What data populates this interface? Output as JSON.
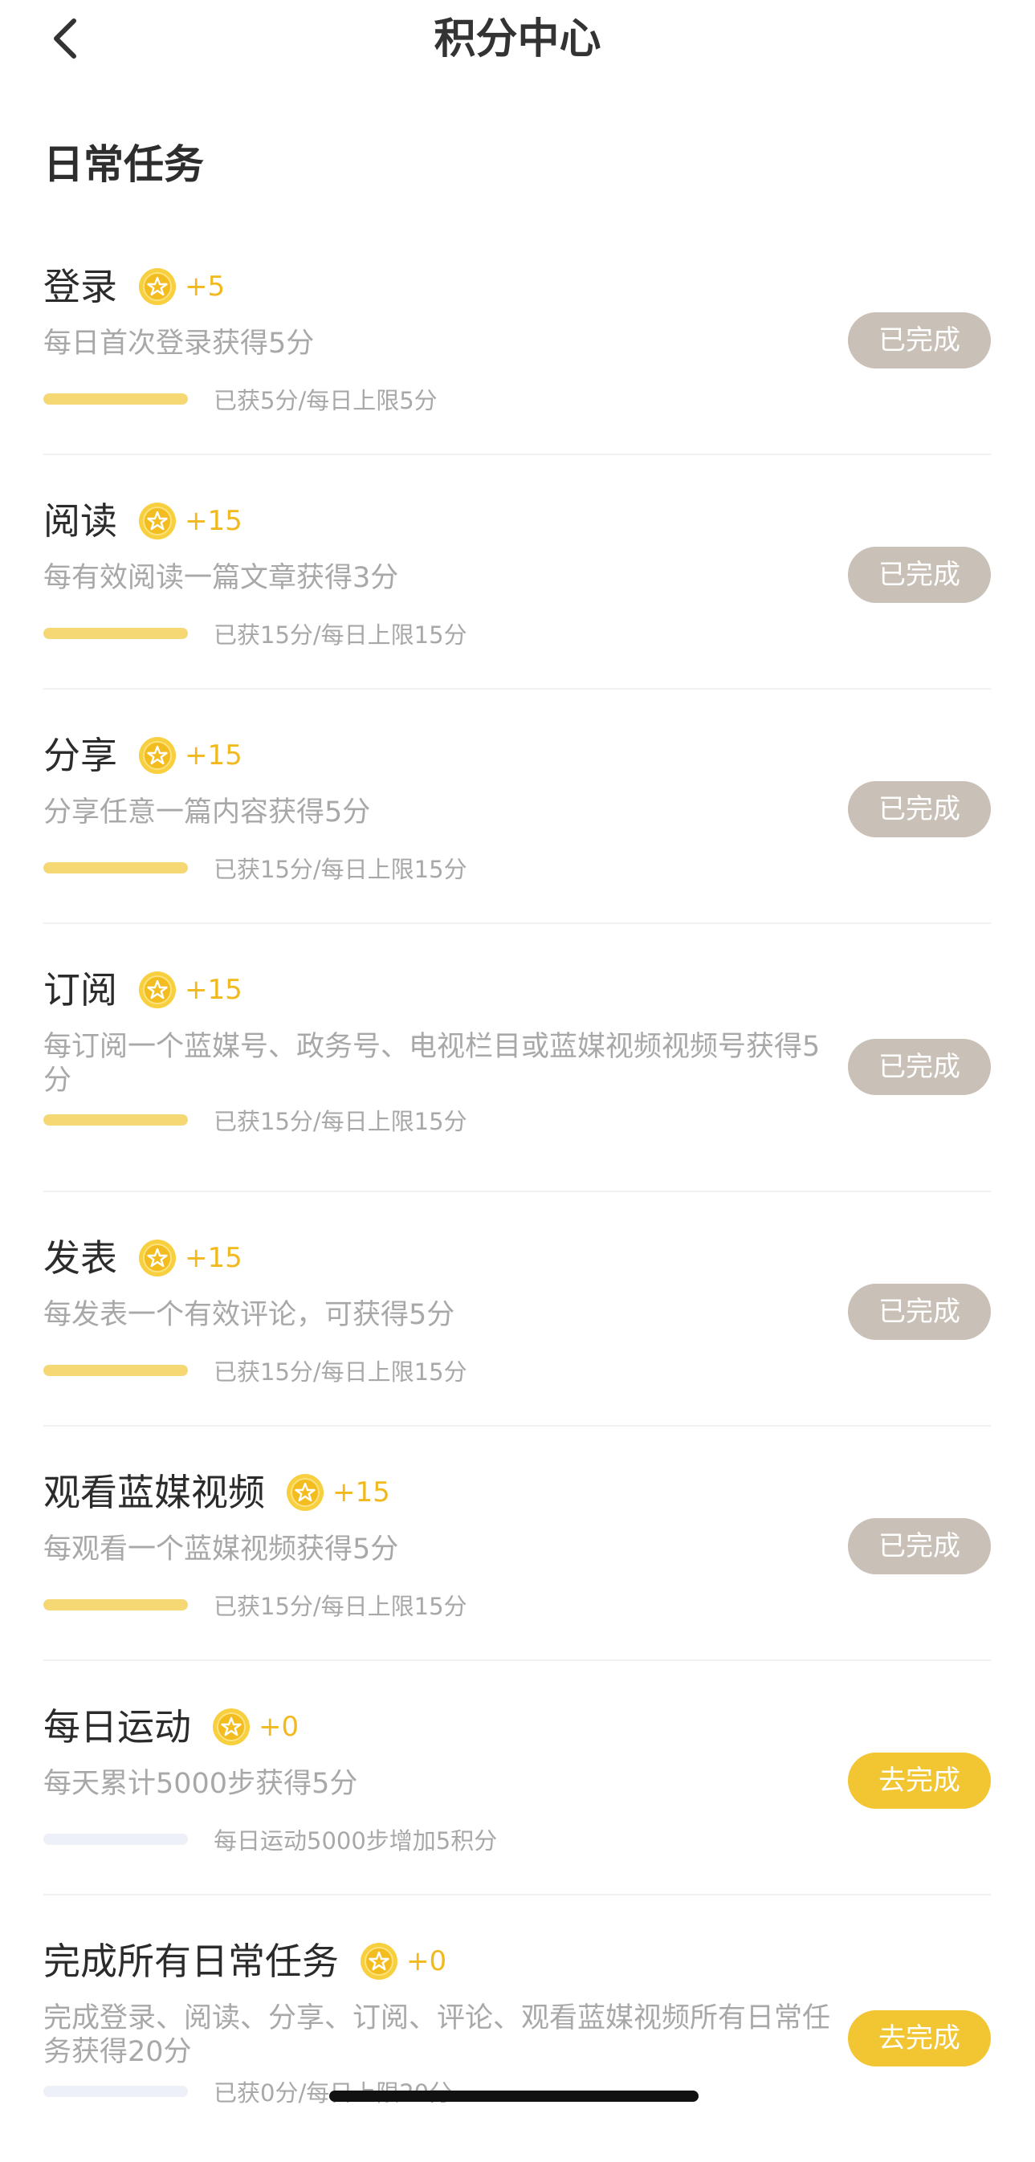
{
  "header": {
    "title": "积分中心"
  },
  "section": {
    "title": "日常任务"
  },
  "colors": {
    "accent": "#f2c532",
    "done": "#c9c0b7",
    "progress": "#f5d774",
    "track": "#eef0f7"
  },
  "tasks": [
    {
      "name": "登录",
      "points": "+5",
      "desc": "每日首次登录获得5分",
      "progress_text": "已获5分/每日上限5分",
      "progress": 1,
      "status": "已完成",
      "done": true
    },
    {
      "name": "阅读",
      "points": "+15",
      "desc": "每有效阅读一篇文章获得3分",
      "progress_text": "已获15分/每日上限15分",
      "progress": 1,
      "status": "已完成",
      "done": true
    },
    {
      "name": "分享",
      "points": "+15",
      "desc": "分享任意一篇内容获得5分",
      "progress_text": "已获15分/每日上限15分",
      "progress": 1,
      "status": "已完成",
      "done": true
    },
    {
      "name": "订阅",
      "points": "+15",
      "desc": "每订阅一个蓝媒号、政务号、电视栏目或蓝媒视频视频号获得5分",
      "progress_text": "已获15分/每日上限15分",
      "progress": 1,
      "status": "已完成",
      "done": true
    },
    {
      "name": "发表",
      "points": "+15",
      "desc": "每发表一个有效评论，可获得5分",
      "progress_text": "已获15分/每日上限15分",
      "progress": 1,
      "status": "已完成",
      "done": true
    },
    {
      "name": "观看蓝媒视频",
      "points": "+15",
      "desc": "每观看一个蓝媒视频获得5分",
      "progress_text": "已获15分/每日上限15分",
      "progress": 1,
      "status": "已完成",
      "done": true
    },
    {
      "name": "每日运动",
      "points": "+0",
      "desc": "每天累计5000步获得5分",
      "progress_text": "每日运动5000步增加5积分",
      "progress": 0,
      "status": "去完成",
      "done": false
    },
    {
      "name": "完成所有日常任务",
      "points": "+0",
      "desc": "完成登录、阅读、分享、订阅、评论、观看蓝媒视频所有日常任务获得20分",
      "progress_text": "已获0分/每日上限20分",
      "progress": 0,
      "status": "去完成",
      "done": false
    }
  ]
}
